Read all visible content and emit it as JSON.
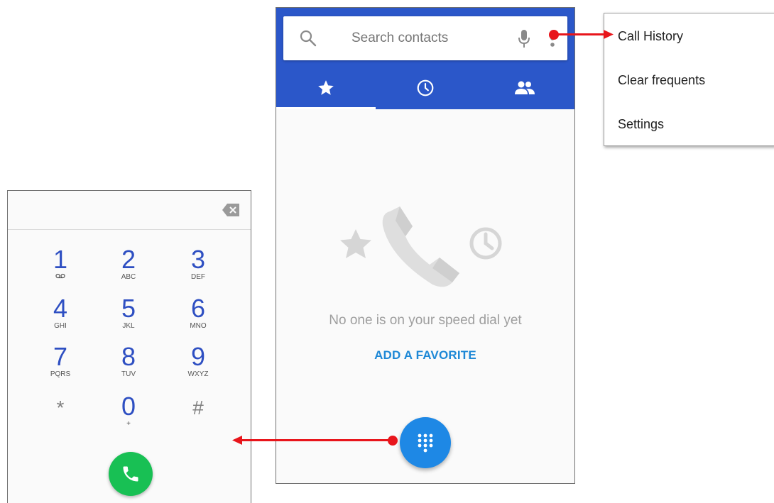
{
  "search": {
    "placeholder": "Search contacts"
  },
  "tabs": [
    {
      "icon": "star-icon",
      "active": true
    },
    {
      "icon": "clock-icon",
      "active": false
    },
    {
      "icon": "people-icon",
      "active": false
    }
  ],
  "empty_state": {
    "message": "No one is on your speed dial yet",
    "action": "ADD A FAVORITE"
  },
  "menu": {
    "items": [
      "Call History",
      "Clear frequents",
      "Settings"
    ]
  },
  "dialpad": {
    "keys": [
      {
        "digit": "1",
        "letters": "voicemail-icon"
      },
      {
        "digit": "2",
        "letters": "ABC"
      },
      {
        "digit": "3",
        "letters": "DEF"
      },
      {
        "digit": "4",
        "letters": "GHI"
      },
      {
        "digit": "5",
        "letters": "JKL"
      },
      {
        "digit": "6",
        "letters": "MNO"
      },
      {
        "digit": "7",
        "letters": "PQRS"
      },
      {
        "digit": "8",
        "letters": "TUV"
      },
      {
        "digit": "9",
        "letters": "WXYZ"
      },
      {
        "digit": "*",
        "letters": ""
      },
      {
        "digit": "0",
        "letters": "+"
      },
      {
        "digit": "#",
        "letters": ""
      }
    ]
  },
  "colors": {
    "appbar": "#2b57c9",
    "accent": "#1e88e5",
    "call": "#18c054",
    "annotation_arrow": "#e8151b"
  }
}
